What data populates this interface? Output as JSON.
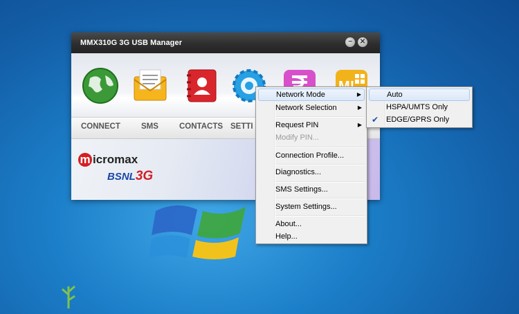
{
  "app": {
    "title": "MMX310G 3G USB Manager",
    "minimize_glyph": "−",
    "close_glyph": "✕",
    "nav": [
      "CONNECT",
      "SMS",
      "CONTACTS",
      "SETTI"
    ],
    "brand_micromax_m": "m",
    "brand_micromax_rest": "icromax",
    "brand_bsnl": "BSNL",
    "brand_3g": "3G",
    "icon_badge": "M!"
  },
  "menu": {
    "items": {
      "network_mode": "Network Mode",
      "network_selection": "Network Selection",
      "request_pin": "Request PIN",
      "modify_pin": "Modify PIN...",
      "connection_profile": "Connection Profile...",
      "diagnostics": "Diagnostics...",
      "sms_settings": "SMS Settings...",
      "system_settings": "System Settings...",
      "about": "About...",
      "help": "Help..."
    }
  },
  "submenu": {
    "auto": "Auto",
    "hspa": "HSPA/UMTS Only",
    "edge": "EDGE/GPRS Only",
    "selected": "EDGE/GPRS Only"
  },
  "colors": {
    "desktop": "#1c7fc9",
    "highlight_border": "#a9c8ee",
    "brand_red": "#d21f24",
    "brand_blue": "#1b47a6"
  }
}
